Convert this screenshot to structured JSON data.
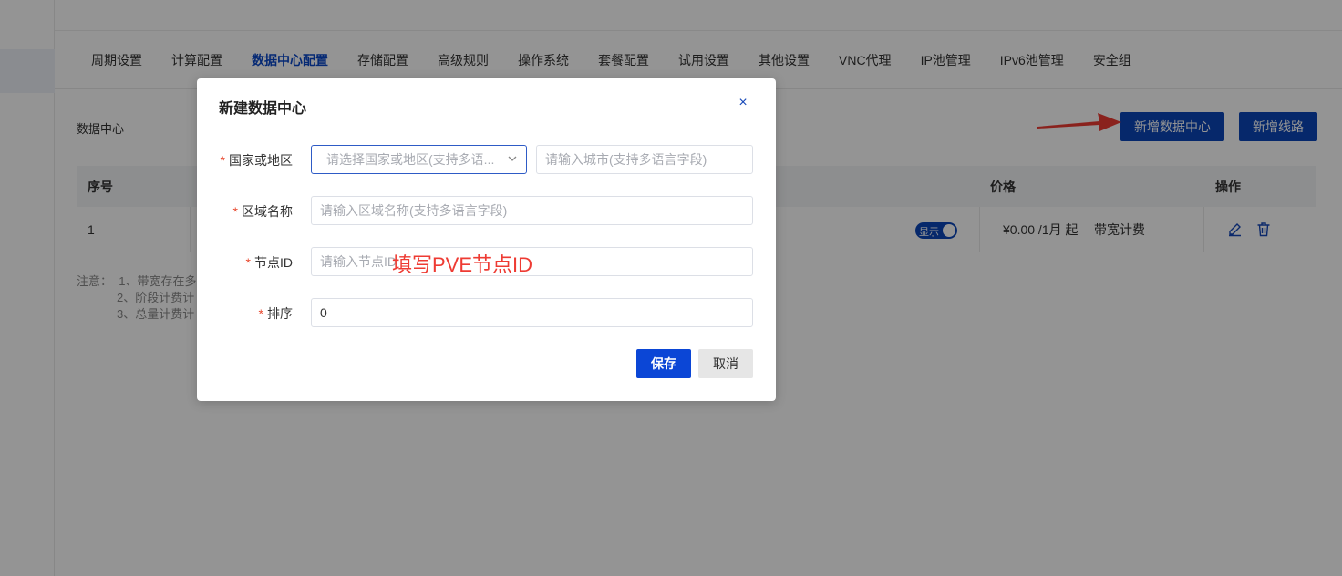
{
  "tabs": [
    {
      "label": "周期设置"
    },
    {
      "label": "计算配置"
    },
    {
      "label": "数据中心配置",
      "active": true
    },
    {
      "label": "存储配置"
    },
    {
      "label": "高级规则"
    },
    {
      "label": "操作系统"
    },
    {
      "label": "套餐配置"
    },
    {
      "label": "试用设置"
    },
    {
      "label": "其他设置"
    },
    {
      "label": "VNC代理"
    },
    {
      "label": "IP池管理"
    },
    {
      "label": "IPv6池管理"
    },
    {
      "label": "安全组"
    }
  ],
  "section": {
    "title": "数据中心",
    "add_datacenter_label": "新增数据中心",
    "add_line_label": "新增线路"
  },
  "table": {
    "headers": {
      "index": "序号",
      "price": "价格",
      "actions": "操作"
    },
    "rows": [
      {
        "index": "1",
        "toggle_label": "显示",
        "price": "¥0.00 /1月 起",
        "billing": "带宽计费"
      }
    ]
  },
  "notes": {
    "prefix": "注意：",
    "lines": [
      "1、带宽存在多",
      "2、阶段计费计",
      "3、总量计费计"
    ]
  },
  "modal": {
    "title": "新建数据中心",
    "fields": {
      "country_label": "国家或地区",
      "country_placeholder": "请选择国家或地区(支持多语...",
      "city_placeholder": "请输入城市(支持多语言字段)",
      "region_label": "区域名称",
      "region_placeholder": "请输入区域名称(支持多语言字段)",
      "node_label": "节点ID",
      "node_placeholder": "请输入节点ID",
      "sort_label": "排序",
      "sort_value": "0"
    },
    "annotation": "填写PVE节点ID",
    "save_label": "保存",
    "cancel_label": "取消"
  },
  "colors": {
    "primary": "#0b46b9",
    "required": "#e8472d",
    "annotation": "#ee3b33"
  }
}
